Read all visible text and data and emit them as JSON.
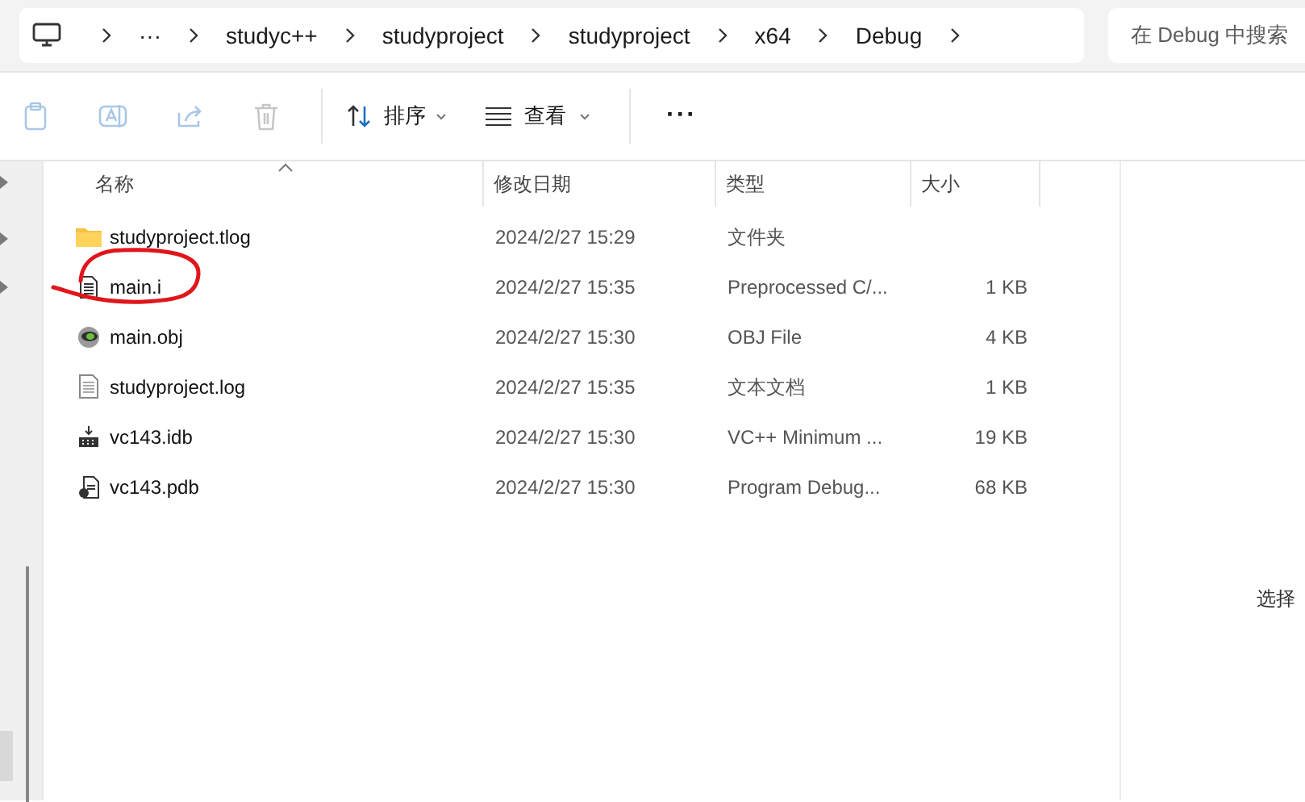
{
  "breadcrumb": [
    "···",
    "studyc++",
    "studyproject",
    "studyproject",
    "x64",
    "Debug"
  ],
  "search": {
    "placeholder": "在 Debug 中搜索"
  },
  "toolbar": {
    "sort": "排序",
    "view": "查看",
    "more": "···"
  },
  "table": {
    "columns": [
      "名称",
      "修改日期",
      "类型",
      "大小"
    ],
    "rows": [
      {
        "kind": "folder",
        "name": "studyproject.tlog",
        "date": "2024/2/27 15:29",
        "type": "文件夹",
        "size": "",
        "circled": false
      },
      {
        "kind": "text",
        "name": "main.i",
        "date": "2024/2/27 15:35",
        "type": "Preprocessed C/...",
        "size": "1 KB",
        "circled": true
      },
      {
        "kind": "obj",
        "name": "main.obj",
        "date": "2024/2/27 15:30",
        "type": "OBJ File",
        "size": "4 KB",
        "circled": false
      },
      {
        "kind": "log",
        "name": "studyproject.log",
        "date": "2024/2/27 15:35",
        "type": "文本文档",
        "size": "1 KB",
        "circled": false
      },
      {
        "kind": "idb",
        "name": "vc143.idb",
        "date": "2024/2/27 15:30",
        "type": "VC++ Minimum ...",
        "size": "19 KB",
        "circled": false
      },
      {
        "kind": "pdb",
        "name": "vc143.pdb",
        "date": "2024/2/27 15:30",
        "type": "Program Debug...",
        "size": "68 KB",
        "circled": false
      }
    ]
  },
  "preview": {
    "text": "选择"
  }
}
